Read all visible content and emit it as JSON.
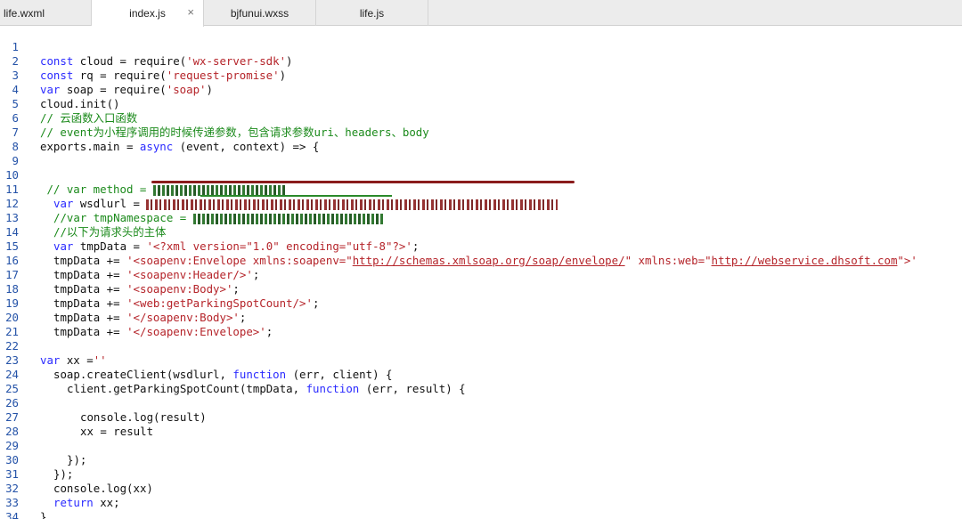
{
  "tabs": [
    {
      "label": "life.wxml"
    },
    {
      "label": "index.js",
      "close": "×"
    },
    {
      "label": "bjfunui.wxss"
    },
    {
      "label": "life.js"
    }
  ],
  "lines": [
    {
      "n": "1"
    },
    {
      "n": "2"
    },
    {
      "n": "3"
    },
    {
      "n": "4"
    },
    {
      "n": "5"
    },
    {
      "n": "6"
    },
    {
      "n": "7"
    },
    {
      "n": "8"
    },
    {
      "n": "9"
    },
    {
      "n": "10"
    },
    {
      "n": "11"
    },
    {
      "n": "12"
    },
    {
      "n": "13"
    },
    {
      "n": "14"
    },
    {
      "n": "15"
    },
    {
      "n": "16"
    },
    {
      "n": "17"
    },
    {
      "n": "18"
    },
    {
      "n": "19"
    },
    {
      "n": "20"
    },
    {
      "n": "21"
    },
    {
      "n": "22"
    },
    {
      "n": "23"
    },
    {
      "n": "24"
    },
    {
      "n": "25"
    },
    {
      "n": "26"
    },
    {
      "n": "27"
    },
    {
      "n": "28"
    },
    {
      "n": "29"
    },
    {
      "n": "30"
    },
    {
      "n": "31"
    },
    {
      "n": "32"
    },
    {
      "n": "33"
    },
    {
      "n": "34"
    }
  ],
  "code": {
    "l1": {
      "kw": "const",
      "a": " cloud = require(",
      "s": "'wx-server-sdk'",
      "b": ")"
    },
    "l2": {
      "kw": "const",
      "a": " rq = require(",
      "s": "'request-promise'",
      "b": ")"
    },
    "l3": {
      "kw": "var",
      "a": " soap = require(",
      "s": "'soap'",
      "b": ")"
    },
    "l4": {
      "a": "cloud.init()"
    },
    "l5": {
      "c": "// 云函数入口函数"
    },
    "l6": {
      "c": "// event为小程序调用的时候传递参数，包含请求参数uri、headers、body"
    },
    "l7": {
      "a": "exports.main = ",
      "kw": "async",
      "b": " (event, context) => {"
    },
    "l10": {
      "c": " // var method = "
    },
    "l11": {
      "kw": "var",
      "a": " wsdlurl = "
    },
    "l12": {
      "c": "//var tmpNamespace = "
    },
    "l13": {
      "c": "//以下为请求头的主体"
    },
    "l14": {
      "kw": "var",
      "a": " tmpData = ",
      "s": "'<?xml version=\"1.0\" encoding=\"utf-8\"?>'",
      "b": ";"
    },
    "l15": {
      "a": "tmpData += ",
      "s1": "'<soapenv:Envelope xmlns:soapenv=\"",
      "u1": "http://schemas.xmlsoap.org/soap/envelope/",
      "s2": "\" xmlns:web=\"",
      "u2": "http://webservice.dhsoft.com",
      "s3": "\">'"
    },
    "l16": {
      "a": "tmpData += ",
      "s": "'<soapenv:Header/>'",
      "b": ";"
    },
    "l17": {
      "a": "tmpData += ",
      "s": "'<soapenv:Body>'",
      "b": ";"
    },
    "l18": {
      "a": "tmpData += ",
      "s": "'<web:getParkingSpotCount/>'",
      "b": ";"
    },
    "l19": {
      "a": "tmpData += ",
      "s": "'</soapenv:Body>'",
      "b": ";"
    },
    "l20": {
      "a": "tmpData += ",
      "s": "'</soapenv:Envelope>'",
      "b": ";"
    },
    "l22": {
      "kw": "var",
      "a": " xx =",
      "s": "''"
    },
    "l23": {
      "a": "soap.createClient(wsdlurl, ",
      "kw": "function",
      "b": " (err, client) {"
    },
    "l24": {
      "a": "client.getParkingSpotCount(tmpData, ",
      "kw": "function",
      "b": " (err, result) {"
    },
    "l26": {
      "a": "console.log(result)"
    },
    "l27": {
      "a": "xx = result"
    },
    "l29": {
      "a": "});"
    },
    "l30": {
      "a": "});"
    },
    "l31": {
      "a": "console.log(xx)"
    },
    "l32": {
      "kw": "return",
      "a": " xx;"
    },
    "l33": {
      "a": "}"
    }
  }
}
